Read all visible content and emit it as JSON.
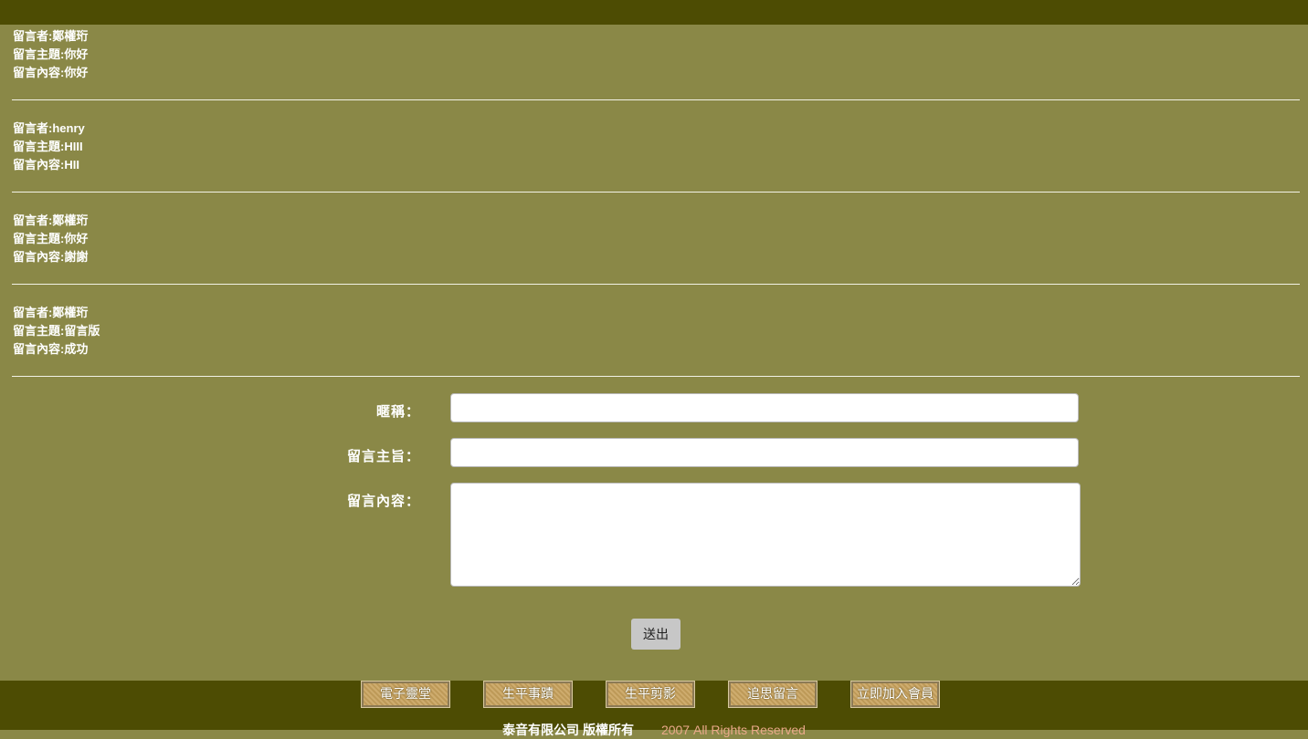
{
  "messages": [
    {
      "author_label": "留言者:",
      "author": "鄭權珩",
      "subject_label": "留言主題:",
      "subject": "你好",
      "content_label": "留言內容:",
      "content": "你好"
    },
    {
      "author_label": "留言者:",
      "author": "henry",
      "subject_label": "留言主題:",
      "subject": "HIII",
      "content_label": "留言內容:",
      "content": "HII"
    },
    {
      "author_label": "留言者:",
      "author": "鄭權珩",
      "subject_label": "留言主題:",
      "subject": "你好",
      "content_label": "留言內容:",
      "content": "謝謝"
    },
    {
      "author_label": "留言者:",
      "author": "鄭權珩",
      "subject_label": "留言主題:",
      "subject": "留言版",
      "content_label": "留言內容:",
      "content": "成功"
    }
  ],
  "form": {
    "nickname_label": "暱稱：",
    "nickname_value": "",
    "subject_label": "留言主旨：",
    "subject_value": "",
    "content_label": "留言內容：",
    "content_value": "",
    "submit_label": "送出"
  },
  "footer": {
    "nav": [
      "電子靈堂",
      "生平事蹟",
      "生平剪影",
      "追思留言",
      "立即加入會員"
    ],
    "copyright": "泰音有限公司 版權所有",
    "rights": "2007 All Rights Reserved"
  },
  "colors": {
    "background": "#8a8847",
    "bar": "#4d4c03",
    "text": "#ffffff",
    "rights_text": "#e9a98a"
  }
}
